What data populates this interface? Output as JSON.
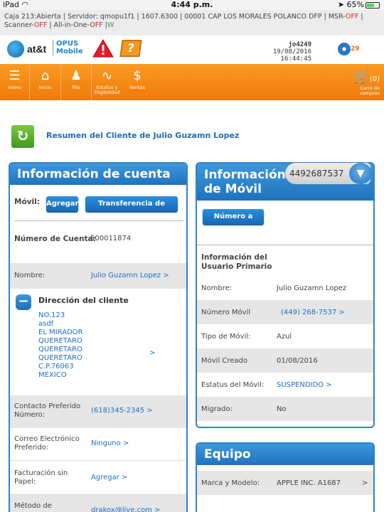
{
  "status": {
    "device": "iPad",
    "time": "4:44 p.m.",
    "battery": "65%",
    "battery_level": 0.65
  },
  "info": {
    "caja": "Caja 213:Abierta",
    "servidor": "Servidor: qmopu1f1",
    "ip": "1607.6300",
    "store": "00001 CAP LOS MORALES POLANCO DFP",
    "msr_label": "MSR-",
    "msr_value": "OFF",
    "scanner_label": "Scanner-",
    "scanner_value": "OFF",
    "allin_label": "All-in-One-",
    "allin_value": "OFF",
    "allin_extra": "W"
  },
  "brand": {
    "att": "at&t",
    "opus_line1": "OPUS",
    "opus_line2": "Mobile",
    "help_icon_text": "?"
  },
  "user": {
    "name": "jo4249",
    "datetime": "19/08/2016 16:44:45",
    "notifications": "29"
  },
  "nav": {
    "items": [
      {
        "label": "menu",
        "icon": "hamburger-icon"
      },
      {
        "label": "Inicio",
        "icon": "home-icon"
      },
      {
        "label": "Filu",
        "icon": "users-icon"
      },
      {
        "label": "Estatus y Eligibilidad",
        "icon": "pulse-icon"
      },
      {
        "label": "Ventas",
        "icon": "dollar-icon"
      }
    ],
    "cart_label": "Carro de compras",
    "cart_count": "(0)"
  },
  "summary_title": "Resumen del Cliente de Julio Guzamn Lopez",
  "account": {
    "title": "Información de cuenta",
    "movil_label": "Móvil:",
    "add_button": "Agregar",
    "transfer_button": "Transferencia de Dominio",
    "account_number_label": "Número de Cuenta:",
    "account_number": "500011874",
    "name_label": "Nombre:",
    "name_value": "Julio Guzamn Lopez",
    "address_title": "Dirección del cliente",
    "address_lines": [
      "NO.123",
      "asdf",
      "EL MIRADOR",
      "QUERETARO",
      "QUERETARO",
      "QUERETARO",
      "C.P.76063",
      "MEXICO"
    ],
    "contact_label1": "Contacto Preferido",
    "contact_label2": "Número:",
    "contact_value": "(618)345-2345",
    "email_label1": "Correo Electrónico",
    "email_label2": "Preferido:",
    "email_value": "Ninguno",
    "billing_label1": "Facturación sin",
    "billing_label2": "Papel:",
    "billing_value": "Agregar",
    "method_label": "Método de",
    "method_value": "drakox@live.com"
  },
  "mobile": {
    "title1": "Información",
    "title2": "de Móvil",
    "phone_number": "4492687537",
    "port_button": "Número a Portar",
    "primary_user_title1": "Información del",
    "primary_user_title2": "Usuario Primario",
    "rows": [
      {
        "label": "Nombre:",
        "value": "Julio Guzamn Lopez"
      },
      {
        "label": "Número Móvil",
        "value": "(449) 268-7537"
      },
      {
        "label": "Tipo de Móvil:",
        "value": "Azul"
      },
      {
        "label": "Móvil Creado",
        "value": "01/08/2016"
      },
      {
        "label": "Estatus del Móvil:",
        "value": "SUSPENDIDO"
      },
      {
        "label": "Migrado:",
        "value": "No"
      }
    ]
  },
  "equipment": {
    "title": "Equipo",
    "brand_label": "Marca y Modelo:",
    "brand_value": "APPLE INC. A1687"
  },
  "colors": {
    "accent": "#f28a12",
    "brand_blue": "#2f82c9",
    "link": "#1f6fc0",
    "off": "#e02020"
  }
}
